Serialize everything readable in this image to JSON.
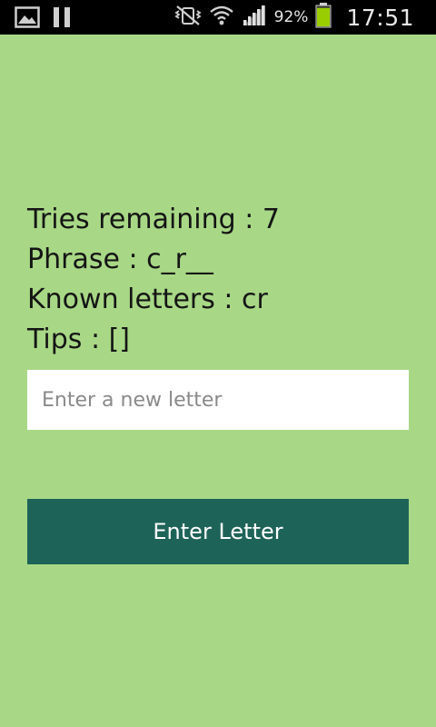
{
  "status_bar": {
    "left_icons": [
      "gallery-notification-icon",
      "pause-icon"
    ],
    "right_icons": [
      "mute-vibrate-icon",
      "wifi-icon",
      "signal-icon",
      "battery-icon"
    ],
    "battery_percent": "92%",
    "battery_level": 0.92,
    "battery_color": "#9acd00",
    "time": "17:51"
  },
  "game": {
    "tries_line": "Tries remaining : 7",
    "phrase_line": "Phrase : c_r__",
    "known_line": "Known letters : cr",
    "tips_line": "Tips : []"
  },
  "letter_input": {
    "value": "",
    "placeholder": "Enter a new letter"
  },
  "enter_button": {
    "label": "Enter Letter"
  },
  "colors": {
    "background": "#a8d886",
    "button": "#1e6358",
    "status_bar": "#000000",
    "text": "#151515"
  }
}
